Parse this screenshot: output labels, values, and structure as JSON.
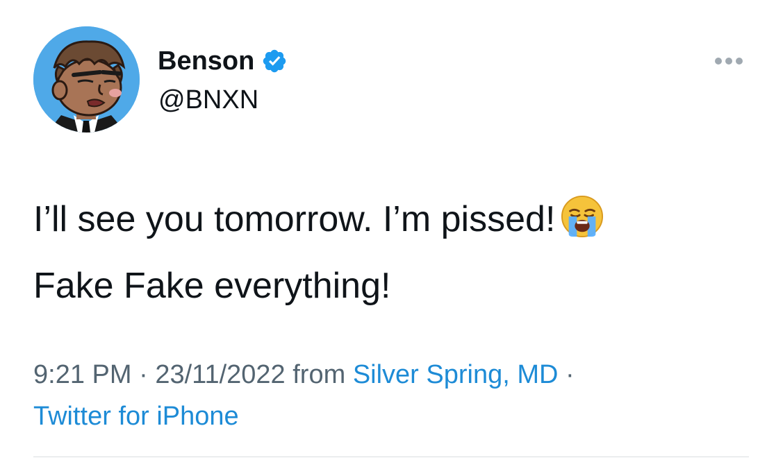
{
  "author": {
    "display_name": "Benson",
    "handle": "@BNXN",
    "verified": true
  },
  "tweet": {
    "line1": "I’ll see you tomorrow. I’m pissed!",
    "line1_emoji": "loudly-crying-face",
    "line2": "Fake Fake everything!"
  },
  "meta": {
    "time": "9:21 PM",
    "sep1": "·",
    "date": "23/11/2022",
    "from_label": "from",
    "location": "Silver Spring, MD",
    "sep2": "·",
    "source": "Twitter for iPhone"
  },
  "icons": {
    "verified": "verified-badge-icon",
    "more": "more-options-icon"
  },
  "colors": {
    "link": "#1d8bd6",
    "verified": "#1d9bf0",
    "avatar_bg": "#4fa9e8",
    "meta_text": "#536471"
  }
}
